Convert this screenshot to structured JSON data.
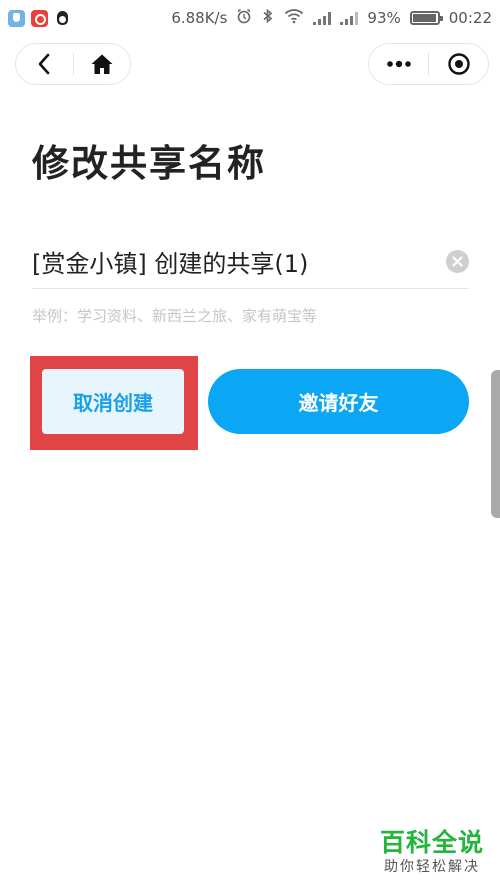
{
  "status_bar": {
    "speed": "6.88K/s",
    "battery": "93%",
    "time": "00:22",
    "icons": [
      "shield-app-icon",
      "music-app-icon",
      "qq-penguin-icon",
      "alarm-icon",
      "bluetooth-icon",
      "wifi-icon",
      "signal-icon",
      "signal-icon",
      "battery-icon"
    ]
  },
  "nav": {
    "back_icon": "chevron-left-icon",
    "home_icon": "home-icon",
    "more_icon": "more-dots-icon",
    "close_icon": "target-circle-icon"
  },
  "page": {
    "title": "修改共享名称"
  },
  "form": {
    "name_value": "[赏金小镇] 创建的共享(1)",
    "hint": "举例：学习资料、新西兰之旅、家有萌宝等",
    "clear_icon": "clear-x-icon"
  },
  "actions": {
    "cancel_label": "取消创建",
    "invite_label": "邀请好友"
  },
  "annotation": {
    "highlight_color": "#e04444"
  },
  "watermark": {
    "main": "百科全说",
    "sub": "助你轻松解决"
  },
  "colors": {
    "accent": "#0ba6f4",
    "cancel_bg": "#e7f5fd",
    "cancel_text": "#1aa0e8",
    "watermark_green": "#23b53c"
  }
}
